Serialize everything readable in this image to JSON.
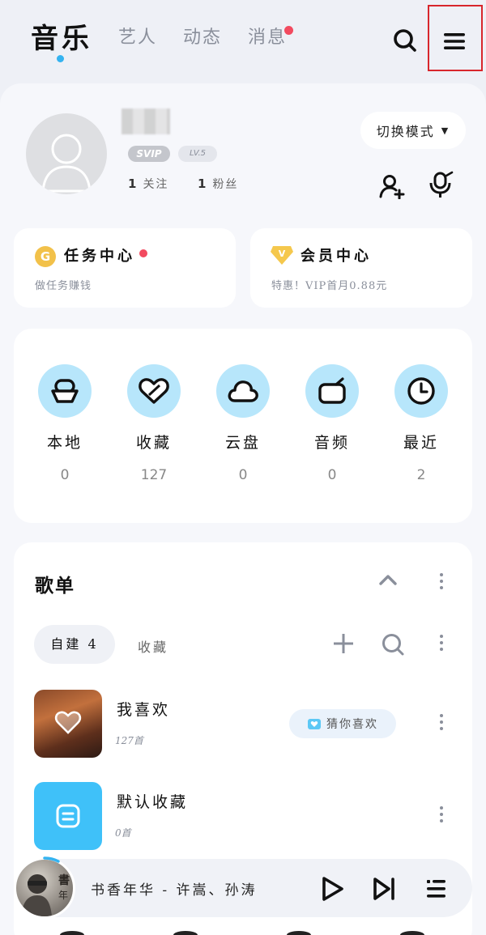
{
  "nav": {
    "tabs": [
      {
        "label": "音乐",
        "active": true
      },
      {
        "label": "艺人",
        "active": false
      },
      {
        "label": "动态",
        "active": false
      },
      {
        "label": "消息",
        "active": false,
        "notification_dot": true
      }
    ],
    "accent_dot_color": "#34b3f0",
    "notification_dot_color": "#f24a5f"
  },
  "profile": {
    "badge_svip": "SVIP",
    "badge_level": "LV.5",
    "following_count": "1",
    "following_label": "关注",
    "followers_count": "1",
    "followers_label": "粉丝",
    "mode_switch_label": "切换模式"
  },
  "task_center": {
    "title": "任务中心",
    "subtitle": "做任务赚钱",
    "coin_letter": "G"
  },
  "vip_center": {
    "title": "会员中心",
    "subtitle": "特惠！VIP首月0.88元",
    "badge_letter": "V"
  },
  "quick_access": [
    {
      "label": "本地",
      "count": "0",
      "icon": "local-icon"
    },
    {
      "label": "收藏",
      "count": "127",
      "icon": "collect-icon"
    },
    {
      "label": "云盘",
      "count": "0",
      "icon": "cloud-icon"
    },
    {
      "label": "音频",
      "count": "0",
      "icon": "audio-icon"
    },
    {
      "label": "最近",
      "count": "2",
      "icon": "clock-icon"
    }
  ],
  "playlists": {
    "title": "歌单",
    "tab_created": "自建 4",
    "tab_collected": "收藏",
    "items": [
      {
        "name": "我喜欢",
        "count": "127首",
        "action_label": "猜你喜欢"
      },
      {
        "name": "默认收藏",
        "count": "0首"
      }
    ]
  },
  "player": {
    "now_playing": "书香年华 - 许嵩、孙涛"
  }
}
